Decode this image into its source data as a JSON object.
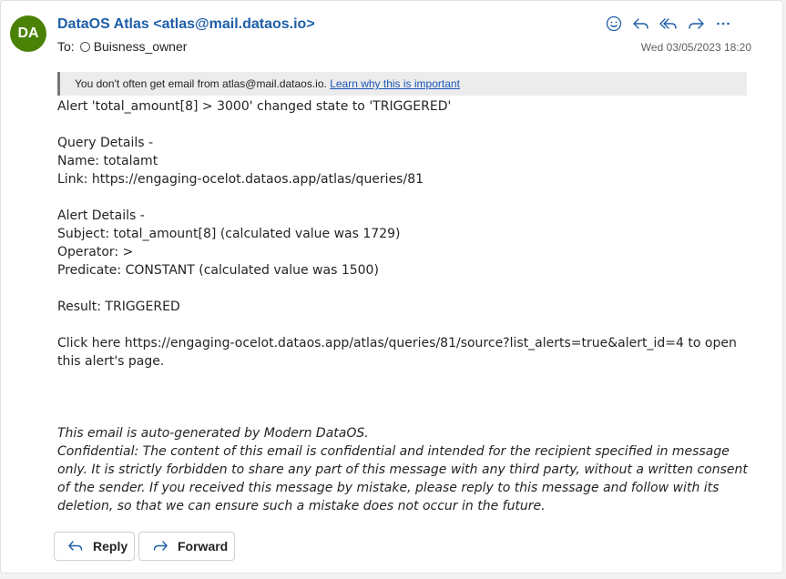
{
  "sender": {
    "initials": "DA",
    "avatar_color": "#498205",
    "display": "DataOS Atlas <atlas@mail.dataos.io>"
  },
  "recipients": {
    "to_label": "To:",
    "to_name": "Buisness_owner"
  },
  "date": "Wed 03/05/2023 18:20",
  "toolbar_icons": [
    "smiley-icon",
    "reply-icon",
    "reply-all-icon",
    "forward-icon",
    "more-icon"
  ],
  "banner": {
    "text": "You don't often get email from atlas@mail.dataos.io. ",
    "link": "Learn why this is important"
  },
  "body": {
    "line1": "Alert 'total_amount[8] > 3000' changed state to 'TRIGGERED'",
    "query_heading": "Query Details -",
    "query_name": "Name: totalamt",
    "query_link": "Link: https://engaging-ocelot.dataos.app/atlas/queries/81",
    "alert_heading": "Alert Details -",
    "alert_subject": "Subject: total_amount[8] (calculated value was 1729)",
    "alert_operator": "Operator: >",
    "alert_predicate": "Predicate: CONSTANT (calculated value was 1500)",
    "result": "Result: TRIGGERED",
    "click_here": "Click here https://engaging-ocelot.dataos.app/atlas/queries/81/source?list_alerts=true&alert_id=4 to open this alert's page."
  },
  "footer": {
    "auto": "This email is auto-generated by Modern DataOS.",
    "confidential": "Confidential: The content of this email is confidential and intended for the recipient specified in message only. It is strictly forbidden to share any part of this message with any third party, without a written consent of the sender. If you received this message by mistake, please reply to this message and follow with its deletion, so that we can ensure such a mistake does not occur in the future."
  },
  "buttons": {
    "reply": "Reply",
    "forward": "Forward"
  },
  "colors": {
    "accent": "#1f5fa8",
    "link": "#1a56b8"
  }
}
